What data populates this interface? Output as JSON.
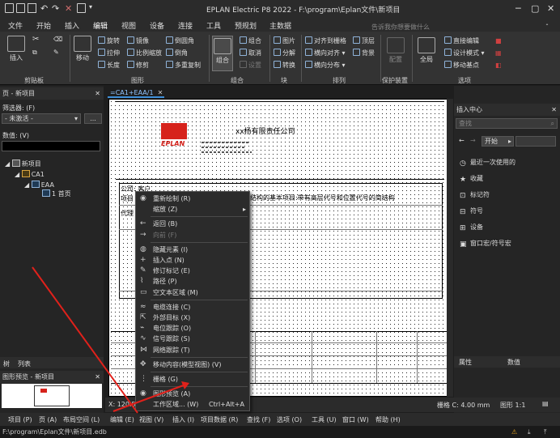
{
  "window": {
    "title": "EPLAN Electric P8 2022 - F:\\program\\Eplan文件\\新项目"
  },
  "menu_tabs": [
    "文件",
    "开始",
    "插入",
    "编辑",
    "视图",
    "设备",
    "连接",
    "工具",
    "预规划",
    "主数据"
  ],
  "ribbon": {
    "insert": "插入",
    "move": "移动",
    "rotate": "旋转",
    "mirror": "镜像",
    "rounded_corner": "倒圆角",
    "stretch": "拉伸",
    "scale": "比例缩放",
    "chamfer": "倒角",
    "length": "长度",
    "trim": "修剪",
    "multi_copy": "多重复制",
    "combine_big": "组合",
    "combine": "组合",
    "cancel": "取消",
    "settings": "设置",
    "image": "图片",
    "split": "分解",
    "convert": "转换",
    "align_grid": "对齐到栅格",
    "h_align": "横向对齐",
    "h_distribute": "横向分布",
    "top_layer": "顶层",
    "background": "背景",
    "search_placeholder": "告诉我你想要做什么",
    "config": "配置",
    "global": "全局",
    "direct_edit": "直接编辑",
    "design_mode": "设计模式",
    "move_attr": "移动基点",
    "groups": [
      "剪贴板",
      "图形",
      "组合",
      "块",
      "排列",
      "保护装置",
      "选项"
    ]
  },
  "left_panel": {
    "title": "页 - 新项目",
    "filter_label": "筛选器: (F)",
    "filter_value": "- 未激活 -",
    "filter_btn": "...",
    "value_label": "数值: (V)",
    "tree": [
      "新项目",
      "CA1",
      "EAA",
      "1 首页"
    ],
    "tabs": [
      "树",
      "列表"
    ],
    "preview_title": "图形预览 - 新项目"
  },
  "canvas": {
    "tab": "=CA1+EAA/1",
    "company": "xx杨有限责任公司",
    "logo_text": "EPLAN",
    "client_label": "公司: 客户",
    "project_label": "项目",
    "project_desc": "结构的基本项目:带有高层代号和位置代号的简结构",
    "agent_label": "代理",
    "status_coord": "X: 120.5",
    "grid_info": "栅格 C: 4.00 mm",
    "scale_info": "图形 1:1"
  },
  "context_menu": [
    {
      "label": "重新绘制 (R)",
      "icon": "eye-icon",
      "enabled": true
    },
    {
      "label": "缩放 (Z)",
      "icon": "",
      "enabled": true,
      "submenu": true
    },
    {
      "sep": true
    },
    {
      "label": "返回 (B)",
      "icon": "back-arrow-icon",
      "enabled": true
    },
    {
      "label": "向前 (F)",
      "icon": "forward-arrow-icon",
      "enabled": false
    },
    {
      "sep": true
    },
    {
      "label": "隐藏元素 (I)",
      "icon": "hide-icon",
      "enabled": true
    },
    {
      "label": "插入点 (N)",
      "icon": "insert-point-icon",
      "enabled": true
    },
    {
      "label": "修订标记 (E)",
      "icon": "revision-icon",
      "enabled": true
    },
    {
      "label": "路径 (P)",
      "icon": "path-icon",
      "enabled": true
    },
    {
      "label": "空文本区域 (M)",
      "icon": "text-area-icon",
      "enabled": true
    },
    {
      "sep": true
    },
    {
      "label": "电缆连接 (C)",
      "icon": "cable-icon",
      "enabled": true
    },
    {
      "label": "外部目标 (X)",
      "icon": "external-icon",
      "enabled": true
    },
    {
      "label": "电位跟踪 (O)",
      "icon": "potential-icon",
      "enabled": true
    },
    {
      "label": "信号跟踪 (S)",
      "icon": "signal-icon",
      "enabled": true
    },
    {
      "label": "网络跟踪 (T)",
      "icon": "network-icon",
      "enabled": true
    },
    {
      "sep": true
    },
    {
      "label": "移动内容(模型视图) (V)",
      "icon": "move-icon",
      "enabled": true
    },
    {
      "sep": true
    },
    {
      "label": "栅格 (G)",
      "icon": "grid-icon",
      "enabled": true
    },
    {
      "sep": true
    },
    {
      "label": "图形预览 (A)",
      "icon": "preview-icon",
      "enabled": true
    },
    {
      "label": "工作区域... (W)",
      "shortcut": "Ctrl+Alt+A",
      "icon": "",
      "enabled": true
    }
  ],
  "right_panel": {
    "title": "插入中心",
    "search_placeholder": "查找",
    "start": "开始",
    "items": [
      "最近一次使用的",
      "收藏",
      "标记符",
      "符号",
      "设备",
      "窗口宏/符号宏"
    ],
    "props_header": [
      "属性",
      "数值"
    ]
  },
  "bottom_menu": [
    "项目 (P)",
    "页 (A)",
    "布局空间 (L)",
    "编辑 (E)",
    "视图 (V)",
    "插入 (I)",
    "项目数据 (R)",
    "查找 (F)",
    "选项 (O)",
    "工具 (U)",
    "窗口 (W)",
    "帮助 (H)"
  ],
  "path_bar": "F:\\program\\Eplan文件\\新项目.edb",
  "colors": {
    "accent": "#3f8fd8",
    "arrow": "#e0211b",
    "logo_red": "#d6221b"
  }
}
